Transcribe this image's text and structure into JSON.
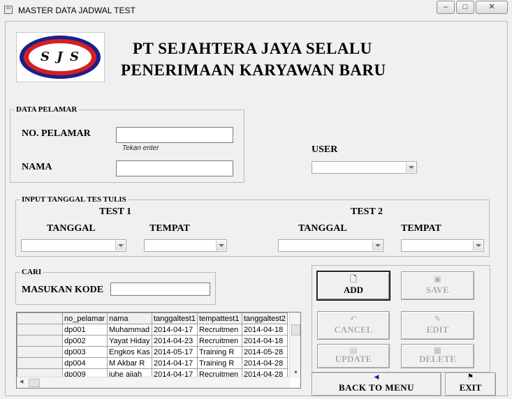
{
  "window": {
    "title": "MASTER DATA JADWAL TEST",
    "minimize": "–",
    "restore": "□",
    "close": "✕"
  },
  "header": {
    "logo_text": "S J S",
    "company": "PT SEJAHTERA JAYA SELALU",
    "subtitle": "PENERIMAAN KARYAWAN BARU"
  },
  "data_pelamar": {
    "legend": "DATA PELAMAR",
    "no_pelamar_label": "NO. PELAMAR",
    "no_pelamar_value": "",
    "hint": "Tekan enter",
    "nama_label": "NAMA",
    "nama_value": ""
  },
  "user": {
    "label": "USER",
    "value": ""
  },
  "input_tanggal": {
    "legend": "INPUT TANGGAL TES TULIS",
    "test1": {
      "title": "TEST 1",
      "tanggal_label": "TANGGAL",
      "tempat_label": "TEMPAT",
      "tanggal_value": "",
      "tempat_value": ""
    },
    "test2": {
      "title": "TEST 2",
      "tanggal_label": "TANGGAL",
      "tempat_label": "TEMPAT",
      "tanggal_value": "",
      "tempat_value": ""
    }
  },
  "cari": {
    "legend": "CARI",
    "label": "MASUKAN KODE",
    "value": ""
  },
  "grid": {
    "columns": [
      "no_pelamar",
      "nama",
      "tanggaltest1",
      "tempattest1",
      "tanggaltest2"
    ],
    "rows": [
      [
        "dp001",
        "Muhammad",
        "2014-04-17",
        "Recruitmen",
        "2014-04-18"
      ],
      [
        "dp002",
        "Yayat Hiday",
        "2014-04-23",
        "Recruitmen",
        "2014-04-18"
      ],
      [
        "dp003",
        "Engkos Kas",
        "2014-05-17",
        "Training R",
        "2014-05-28"
      ],
      [
        "dp004",
        "M Akbar R",
        "2014-04-17",
        "Training R",
        "2014-04-28"
      ],
      [
        "dp009",
        "juhe aijah",
        "2014-04-17",
        "Recruitmen",
        "2014-04-28"
      ]
    ]
  },
  "buttons": {
    "add": "ADD",
    "save": "SAVE",
    "cancel": "CANCEL",
    "edit": "EDIT",
    "update": "UPDATE",
    "delete": "DELETE",
    "back": "BACK TO MENU",
    "exit": "EXIT"
  },
  "icons": {
    "add": "new-document-icon",
    "save": "floppy-disk-icon",
    "cancel": "undo-icon",
    "edit": "edit-pencil-icon",
    "update": "update-icon",
    "delete": "delete-icon",
    "back": "back-arrow-icon",
    "exit": "checkered-flag-icon"
  }
}
